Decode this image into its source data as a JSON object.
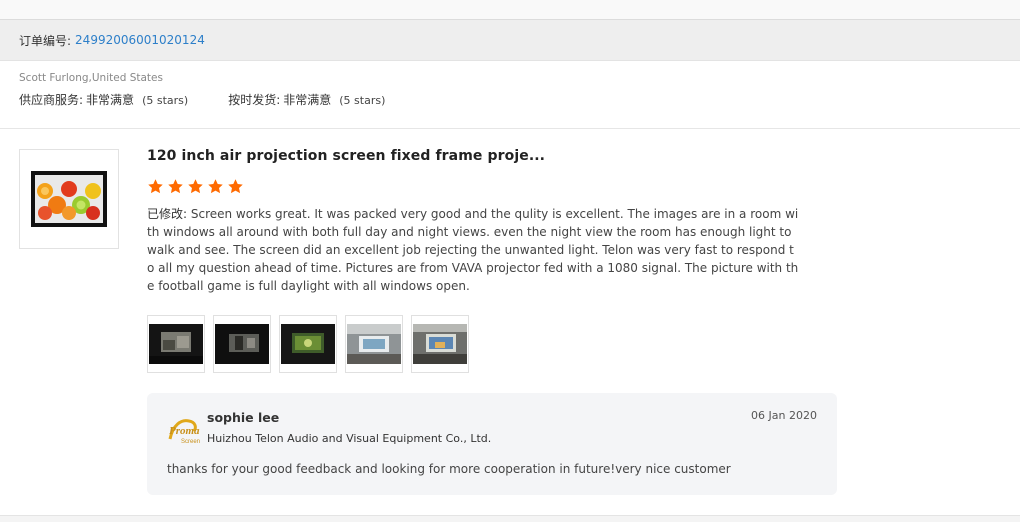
{
  "order": {
    "label": "订单编号:",
    "number": "24992006001020124"
  },
  "buyer": {
    "name_location": "Scott Furlong,United States",
    "supplier_service_label": "供应商服务:",
    "supplier_service_value": "非常满意",
    "supplier_service_stars": "(5 stars)",
    "ontime_label": "按时发货:",
    "ontime_value": "非常满意",
    "ontime_stars": "(5 stars)"
  },
  "product": {
    "title": "120 inch air projection screen fixed frame proje...",
    "rating": 5,
    "star_color": "#ff6a00"
  },
  "review": {
    "edited_prefix": "已修改:",
    "body": " Screen works great. It was packed very good and the qulity is excellent. The images are in a room with windows all around with both full day and night views. even the night view the room has enough light to walk and see. The screen did an excellent job rejecting the unwanted light. Telon was very fast to respond to all my question ahead of time. Pictures are from VAVA projector fed with a 1080 signal. The picture with the football game is full daylight with all windows open."
  },
  "photos": [
    {
      "name": "review-photo-1"
    },
    {
      "name": "review-photo-2"
    },
    {
      "name": "review-photo-3"
    },
    {
      "name": "review-photo-4"
    },
    {
      "name": "review-photo-5"
    }
  ],
  "reply": {
    "name": "sophie lee",
    "company": "Huizhou Telon Audio and Visual Equipment Co., Ltd.",
    "date": "06 Jan 2020",
    "text": "thanks for your good feedback and looking for more cooperation in future!very nice customer"
  },
  "colors": {
    "link_blue": "#2d7fc9",
    "star_orange": "#ff6a00"
  }
}
